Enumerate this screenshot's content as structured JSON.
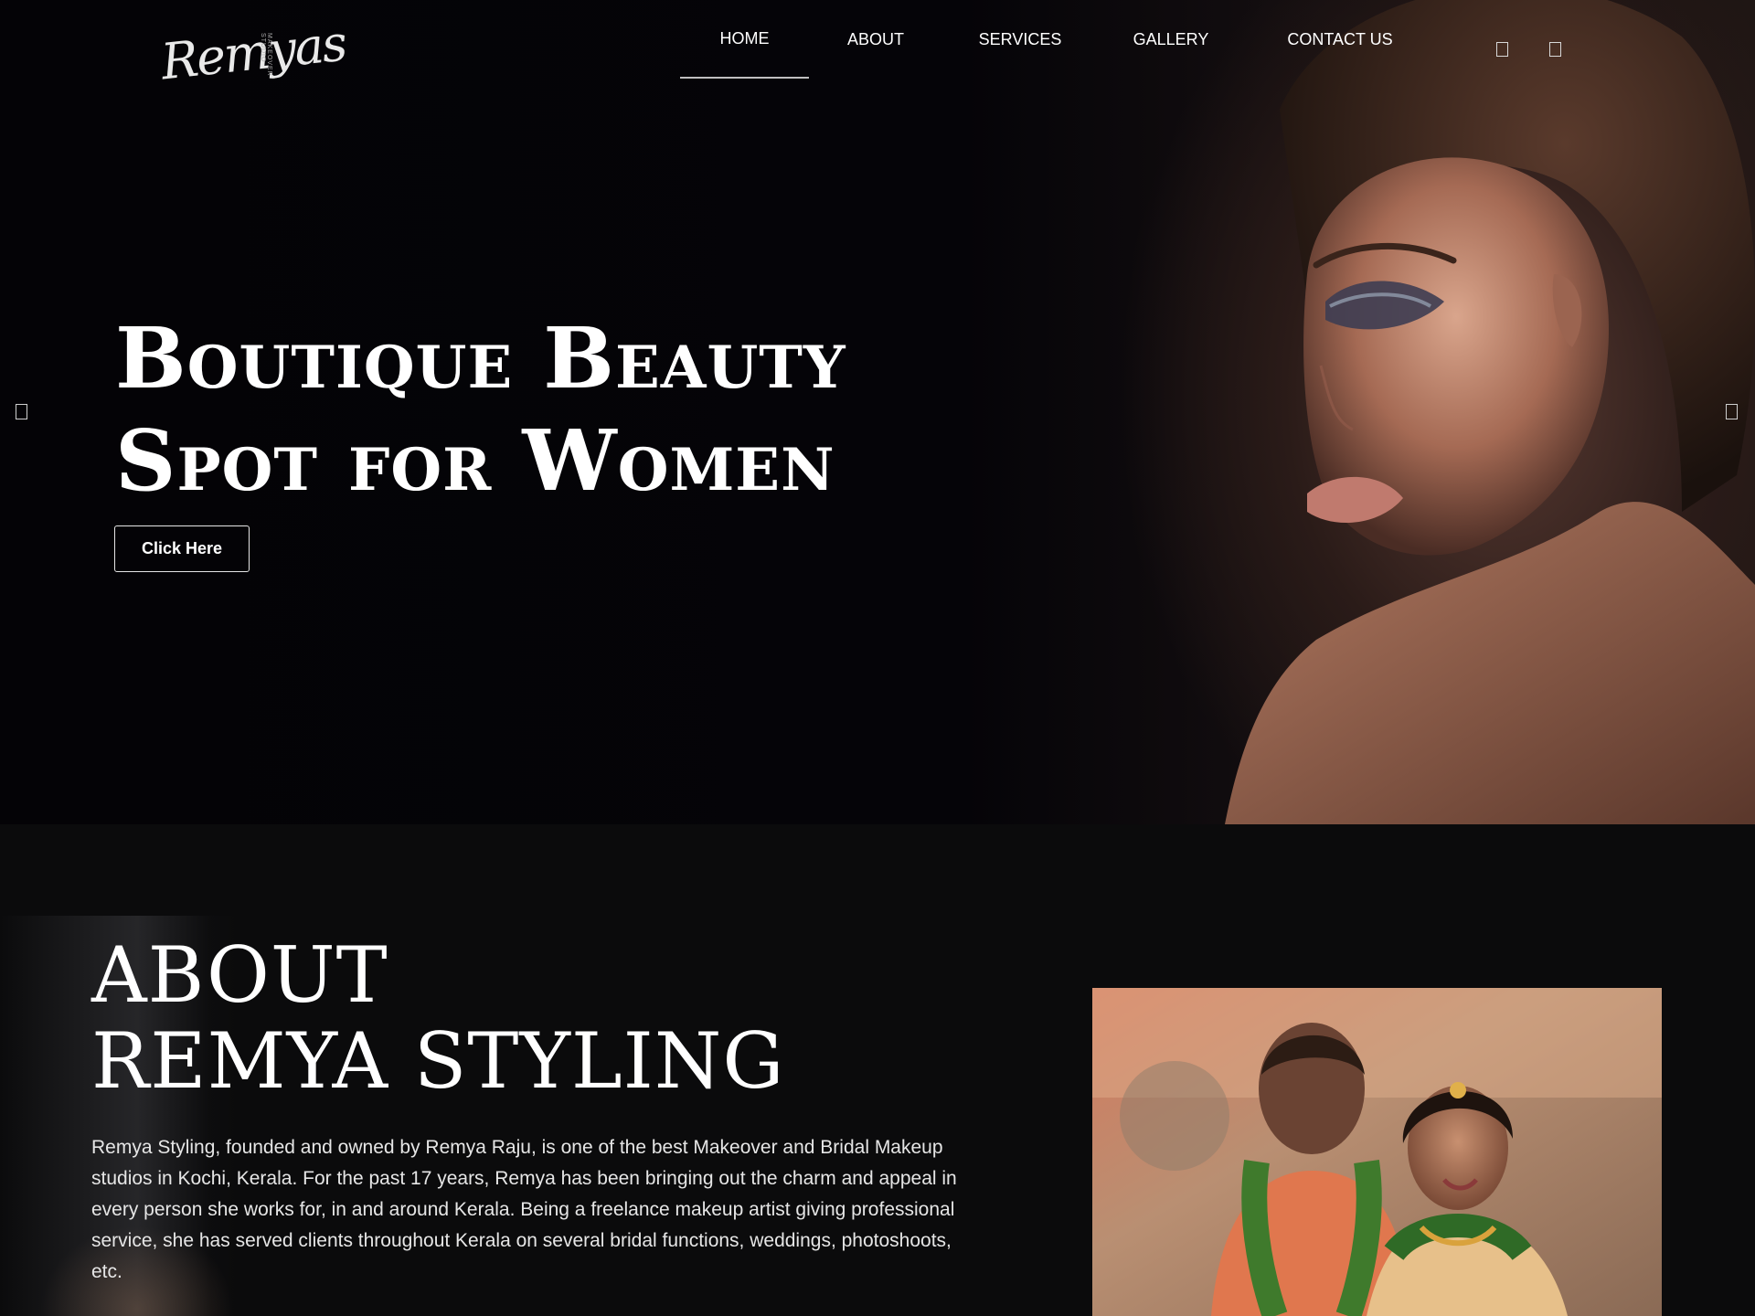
{
  "brand": {
    "logo_text": "Remyas",
    "logo_subtext": "MAKEOVER STUDIO"
  },
  "nav": {
    "items": [
      {
        "label": "HOME",
        "active": true
      },
      {
        "label": "ABOUT"
      },
      {
        "label": "SERVICES"
      },
      {
        "label": "GALLERY"
      },
      {
        "label": "CONTACT US"
      }
    ],
    "icons": [
      "facebook-icon",
      "instagram-icon"
    ]
  },
  "hero": {
    "title_line1": "Boutique Beauty",
    "title_line2": "Spot for Women",
    "button_label": "Click Here",
    "prev_icon": "chevron-left-icon",
    "next_icon": "chevron-right-icon"
  },
  "about": {
    "heading_line1": "ABOUT",
    "heading_line2": "REMYA STYLING",
    "body": "Remya Styling, founded and owned by Remya Raju, is one of the best Makeover and Bridal Makeup studios in Kochi, Kerala. For the past 17 years, Remya has been bringing out the charm and appeal in every person she works for, in and around Kerala. Being a freelance makeup artist giving professional service, she has served clients throughout Kerala on several bridal functions, weddings, photoshoots, etc."
  },
  "colors": {
    "background": "#0b0b0c",
    "hero_dark": "#040306",
    "text": "#ffffff"
  }
}
